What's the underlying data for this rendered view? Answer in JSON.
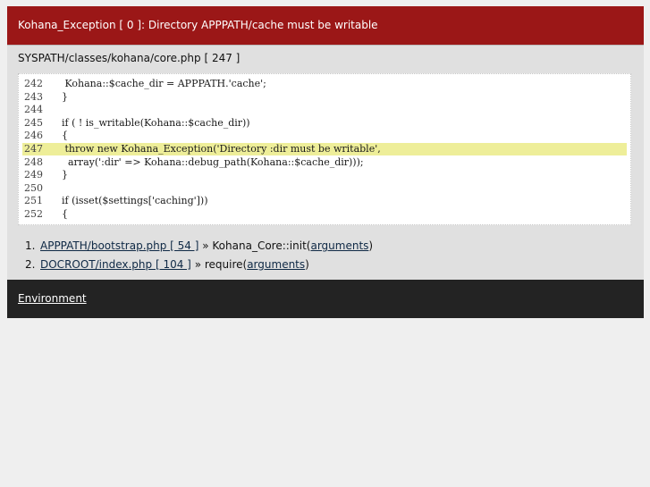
{
  "error": {
    "title": "Kohana_Exception [ 0 ]: Directory APPPATH/cache must be writable",
    "file": "SYSPATH/classes/kohana/core.php [ 247 ]"
  },
  "source": {
    "lines": [
      {
        "num": "242",
        "code": " Kohana::$cache_dir = APPPATH.'cache';"
      },
      {
        "num": "243",
        "code": "}"
      },
      {
        "num": "244",
        "code": ""
      },
      {
        "num": "245",
        "code": "if ( ! is_writable(Kohana::$cache_dir))"
      },
      {
        "num": "246",
        "code": "{"
      },
      {
        "num": "247",
        "code": " throw new Kohana_Exception('Directory :dir must be writable',"
      },
      {
        "num": "248",
        "code": "  array(':dir' => Kohana::debug_path(Kohana::$cache_dir)));"
      },
      {
        "num": "249",
        "code": "}"
      },
      {
        "num": "250",
        "code": ""
      },
      {
        "num": "251",
        "code": "if (isset($settings['caching']))"
      },
      {
        "num": "252",
        "code": "{"
      }
    ]
  },
  "trace": [
    {
      "num": "1.",
      "file": "APPPATH/bootstrap.php [ 54 ]",
      "sep": " » ",
      "func": "Kohana_Core::init(",
      "args": "arguments",
      "close": ")"
    },
    {
      "num": "2.",
      "file": "DOCROOT/index.php [ 104 ]",
      "sep": " » ",
      "func": "require(",
      "args": "arguments",
      "close": ")"
    }
  ],
  "footer": {
    "environment_label": "Environment"
  }
}
